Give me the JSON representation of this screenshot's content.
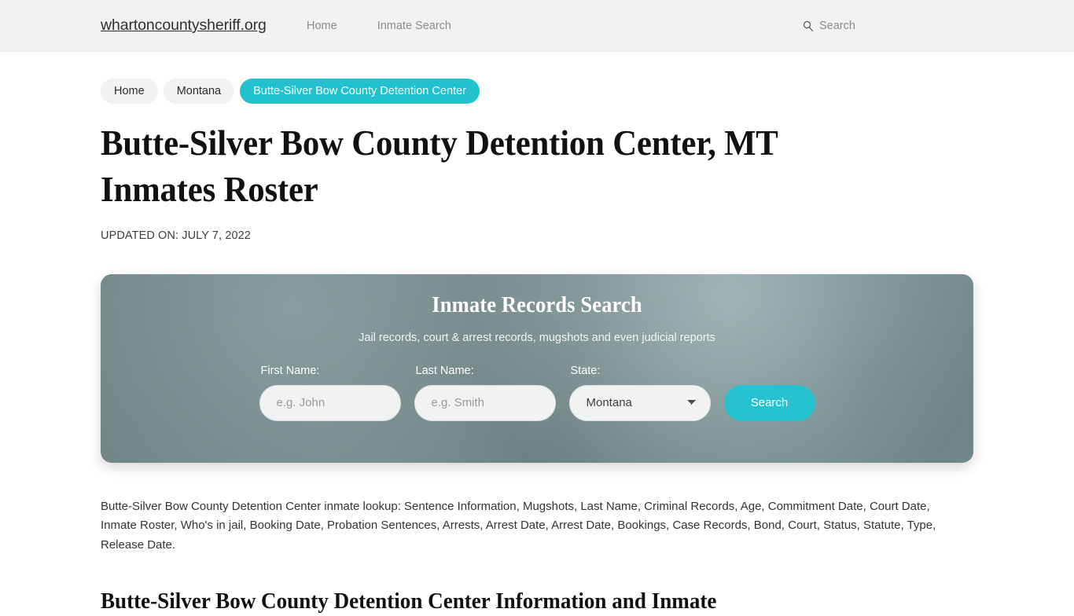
{
  "header": {
    "logo": "whartoncountysheriff.org",
    "nav": [
      {
        "label": "Home"
      },
      {
        "label": "Inmate Search"
      }
    ],
    "search_label": "Search",
    "search_icon": "search-icon"
  },
  "breadcrumb": [
    {
      "label": "Home",
      "active": false
    },
    {
      "label": "Montana",
      "active": false
    },
    {
      "label": "Butte-Silver Bow County Detention Center",
      "active": true
    }
  ],
  "main": {
    "title": "Butte-Silver Bow County Detention Center, MT Inmates Roster",
    "updated": "UPDATED ON: JULY 7, 2022",
    "paragraph": "Butte-Silver Bow County Detention Center inmate lookup: Sentence Information, Mugshots, Last Name, Criminal Records, Age, Commitment Date, Court Date, Inmate Roster, Who's in jail, Booking Date, Probation Sentences, Arrests, Arrest Date, Arrest Date, Bookings, Case Records, Bond, Court, Status, Statute, Type, Release Date.",
    "section_title": "Butte-Silver Bow County Detention Center Information and Inmate"
  },
  "search_card": {
    "title": "Inmate Records Search",
    "subtitle": "Jail records, court & arrest records, mugshots and even judicial reports",
    "first_name_label": "First Name:",
    "first_name_placeholder": "e.g. John",
    "first_name_value": "",
    "last_name_label": "Last Name:",
    "last_name_placeholder": "e.g. Smith",
    "last_name_value": "",
    "state_label": "State:",
    "state_selected": "Montana",
    "state_options": [
      "Montana"
    ],
    "submit_label": "Search"
  },
  "colors": {
    "accent": "#22c1ce",
    "button": "#26c2cf",
    "header_bg": "#f2f2f2",
    "card_base": "#76898b"
  }
}
